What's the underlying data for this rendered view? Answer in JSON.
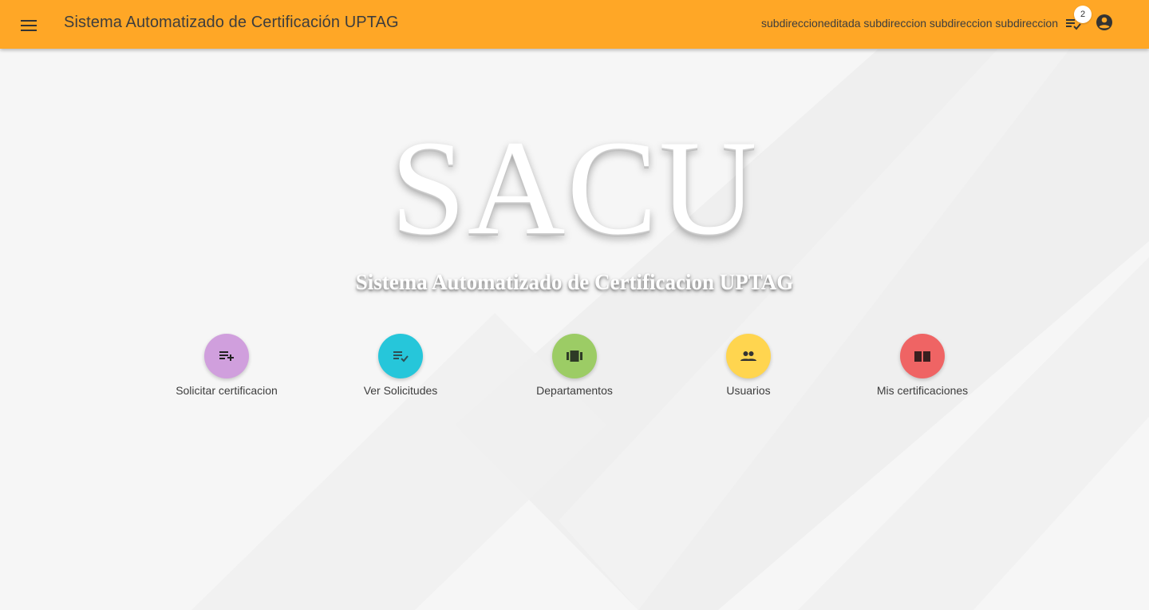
{
  "header": {
    "title": "Sistema Automatizado de Certificación UPTAG",
    "user_name": "subdireccioneditada subdireccion subdireccion subdireccion",
    "notification_count": "2",
    "menu_icon": "menu-icon",
    "notification_icon": "playlist-check-icon",
    "account_icon": "account-circle-icon"
  },
  "hero": {
    "logo": "SACU",
    "subtitle": "Sistema Automatizado de Certificacion UPTAG"
  },
  "shortcuts": [
    {
      "label": "Solicitar certificacion",
      "icon": "playlist-add-icon",
      "color": "#d09fdd"
    },
    {
      "label": "Ver Solicitudes",
      "icon": "playlist-check-icon",
      "color": "#26c6da"
    },
    {
      "label": "Departamentos",
      "icon": "view-array-icon",
      "color": "#9ccc65"
    },
    {
      "label": "Usuarios",
      "icon": "people-icon",
      "color": "#ffd54f"
    },
    {
      "label": "Mis certificaciones",
      "icon": "book-icon",
      "color": "#ef6464"
    }
  ],
  "colors": {
    "appbar": "#ffa726",
    "background": "#f6f6f6",
    "text": "#3d3d3d"
  }
}
